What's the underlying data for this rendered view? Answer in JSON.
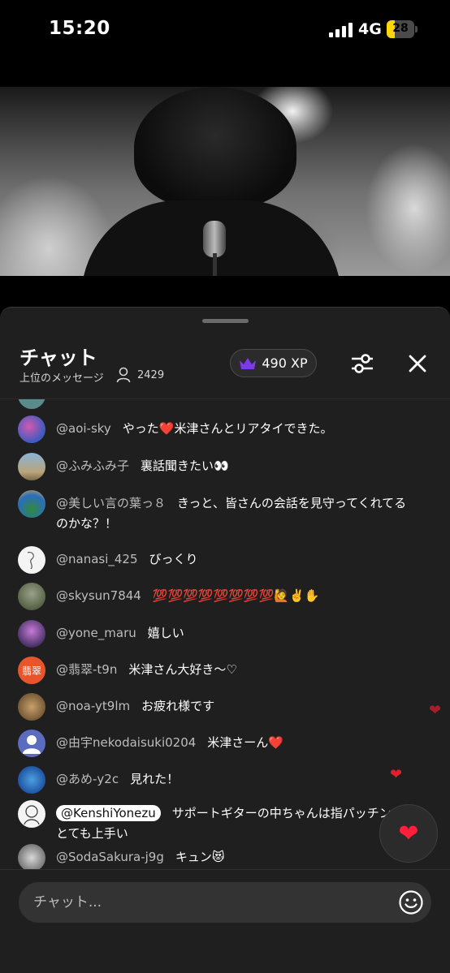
{
  "status_bar": {
    "time": "15:20",
    "network": "4G",
    "battery": "28",
    "battery_level": 0.28
  },
  "chat": {
    "title": "チャット",
    "subtitle": "上位のメッセージ",
    "viewer_count": "2429",
    "xp": "490 XP"
  },
  "messages": [
    {
      "author": "@aoi-sky",
      "text": "やった❤️米津さんとリアタイできた。"
    },
    {
      "author": "@ふみふみ子",
      "text": "裏話聞きたい👀"
    },
    {
      "author": "@美しい言の葉っ８",
      "text": "きっと、皆さんの会話を見守ってくれてるのかな？！"
    },
    {
      "author": "@nanasi_425",
      "text": "びっくり"
    },
    {
      "author": "@skysun7844",
      "text": "💯💯💯💯💯💯💯💯🙋✌️✋"
    },
    {
      "author": "@yone_maru",
      "text": "嬉しい"
    },
    {
      "author": "@翡翠-t9n",
      "text": "米津さん大好き〜♡",
      "avatar_text": "翡翠"
    },
    {
      "author": "@noa-yt9lm",
      "text": "お疲れ様です"
    },
    {
      "author": "@由宇nekodaisuki0204",
      "text": "米津さーん❤️"
    },
    {
      "author": "@あめ-y2c",
      "text": "見れた！"
    },
    {
      "author": "@KenshiYonezu",
      "text": "サポートギターの中ちゃんは指パッチンがとても上手い"
    },
    {
      "author": "@SodaSakura-j9g",
      "text": "キュン😻"
    }
  ],
  "input": {
    "placeholder": "チャット..."
  },
  "colors": {
    "accent_heart": "#e11d2e",
    "crown": "#7c3aed",
    "avatar_hisui": "#e8552a",
    "avatar_yu": "#5b6bc0"
  },
  "icons": [
    "crown-icon",
    "person-icon",
    "sliders-icon",
    "close-icon",
    "smile-icon",
    "heart-icon"
  ]
}
